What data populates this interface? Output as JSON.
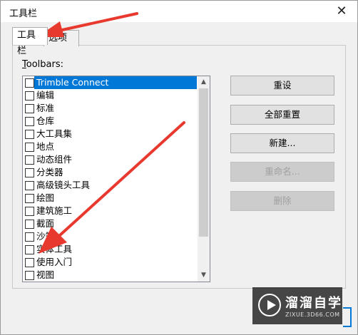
{
  "window": {
    "title": "工具栏",
    "close_glyph": "✕"
  },
  "tabs": [
    {
      "label": "工具栏"
    },
    {
      "label": "选项"
    }
  ],
  "list_label_prefix": "T",
  "list_label_rest": "oolbars:",
  "toolbars": [
    {
      "label": "Trimble Connect",
      "checked": false,
      "selected": true
    },
    {
      "label": "编辑",
      "checked": false
    },
    {
      "label": "标准",
      "checked": false
    },
    {
      "label": "仓库",
      "checked": false
    },
    {
      "label": "大工具集",
      "checked": false
    },
    {
      "label": "地点",
      "checked": false
    },
    {
      "label": "动态组件",
      "checked": false
    },
    {
      "label": "分类器",
      "checked": false
    },
    {
      "label": "高级镜头工具",
      "checked": false
    },
    {
      "label": "绘图",
      "checked": false
    },
    {
      "label": "建筑施工",
      "checked": false
    },
    {
      "label": "截面",
      "checked": false
    },
    {
      "label": "沙箱",
      "checked": false
    },
    {
      "label": "实体工具",
      "checked": false
    },
    {
      "label": "使用入门",
      "checked": false
    },
    {
      "label": "视图",
      "checked": false
    }
  ],
  "buttons": {
    "reset": "重设",
    "reset_all": "全部重置",
    "new": "新建...",
    "rename": "重命名...",
    "delete": "删除"
  },
  "watermark": {
    "name": "溜溜自学",
    "url": "ZIXUE.3D66.COM"
  },
  "colors": {
    "selection": "#0078d7",
    "arrow": "#e8392e"
  }
}
